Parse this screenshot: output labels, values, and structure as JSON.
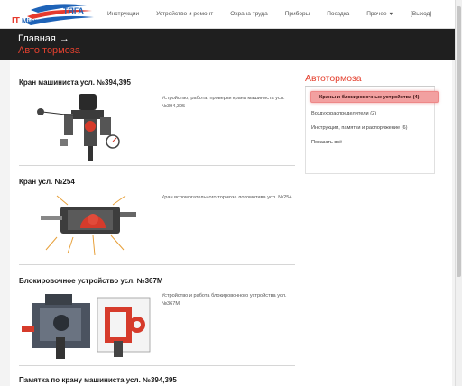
{
  "logo": {
    "brand_it": "IT",
    "brand_mian": "Mian",
    "brand_tyaga": "ТЯГА"
  },
  "nav": {
    "items": [
      "Инструкции",
      "Устройство и ремонт",
      "Охрана труда",
      "Приборы",
      "Поездка"
    ],
    "more_label": "Прочее",
    "logout_label": "[Выход]"
  },
  "breadcrumb": {
    "home": "Главная",
    "separator": "→"
  },
  "page_title": "Авто тормоза",
  "articles": [
    {
      "title": "Кран машиниста усл. №394,395",
      "description": "Устройство, работа, проверки крана машиниста усл. №394,395"
    },
    {
      "title": "Кран усл. №254",
      "description": "Кран вспомогательного тормоза локомотива усл. №254"
    },
    {
      "title": "Блокировочное устройство усл. №367М",
      "description": "Устройство и работа блокировочного устройства усл. №367М"
    },
    {
      "title": "Памятка по крану машиниста усл. №394,395"
    }
  ],
  "sidebar": {
    "title": "Автотормоза",
    "items": [
      "Краны и блокировочные устройства (4)",
      "Воздухораспределители (2)",
      "Инструкции, памятки и распоряжение (6)",
      "Показать всё"
    ]
  },
  "colors": {
    "accent": "#e4412f",
    "hero_bg": "#1f1f1f",
    "active_bg": "#f2a0a0"
  }
}
